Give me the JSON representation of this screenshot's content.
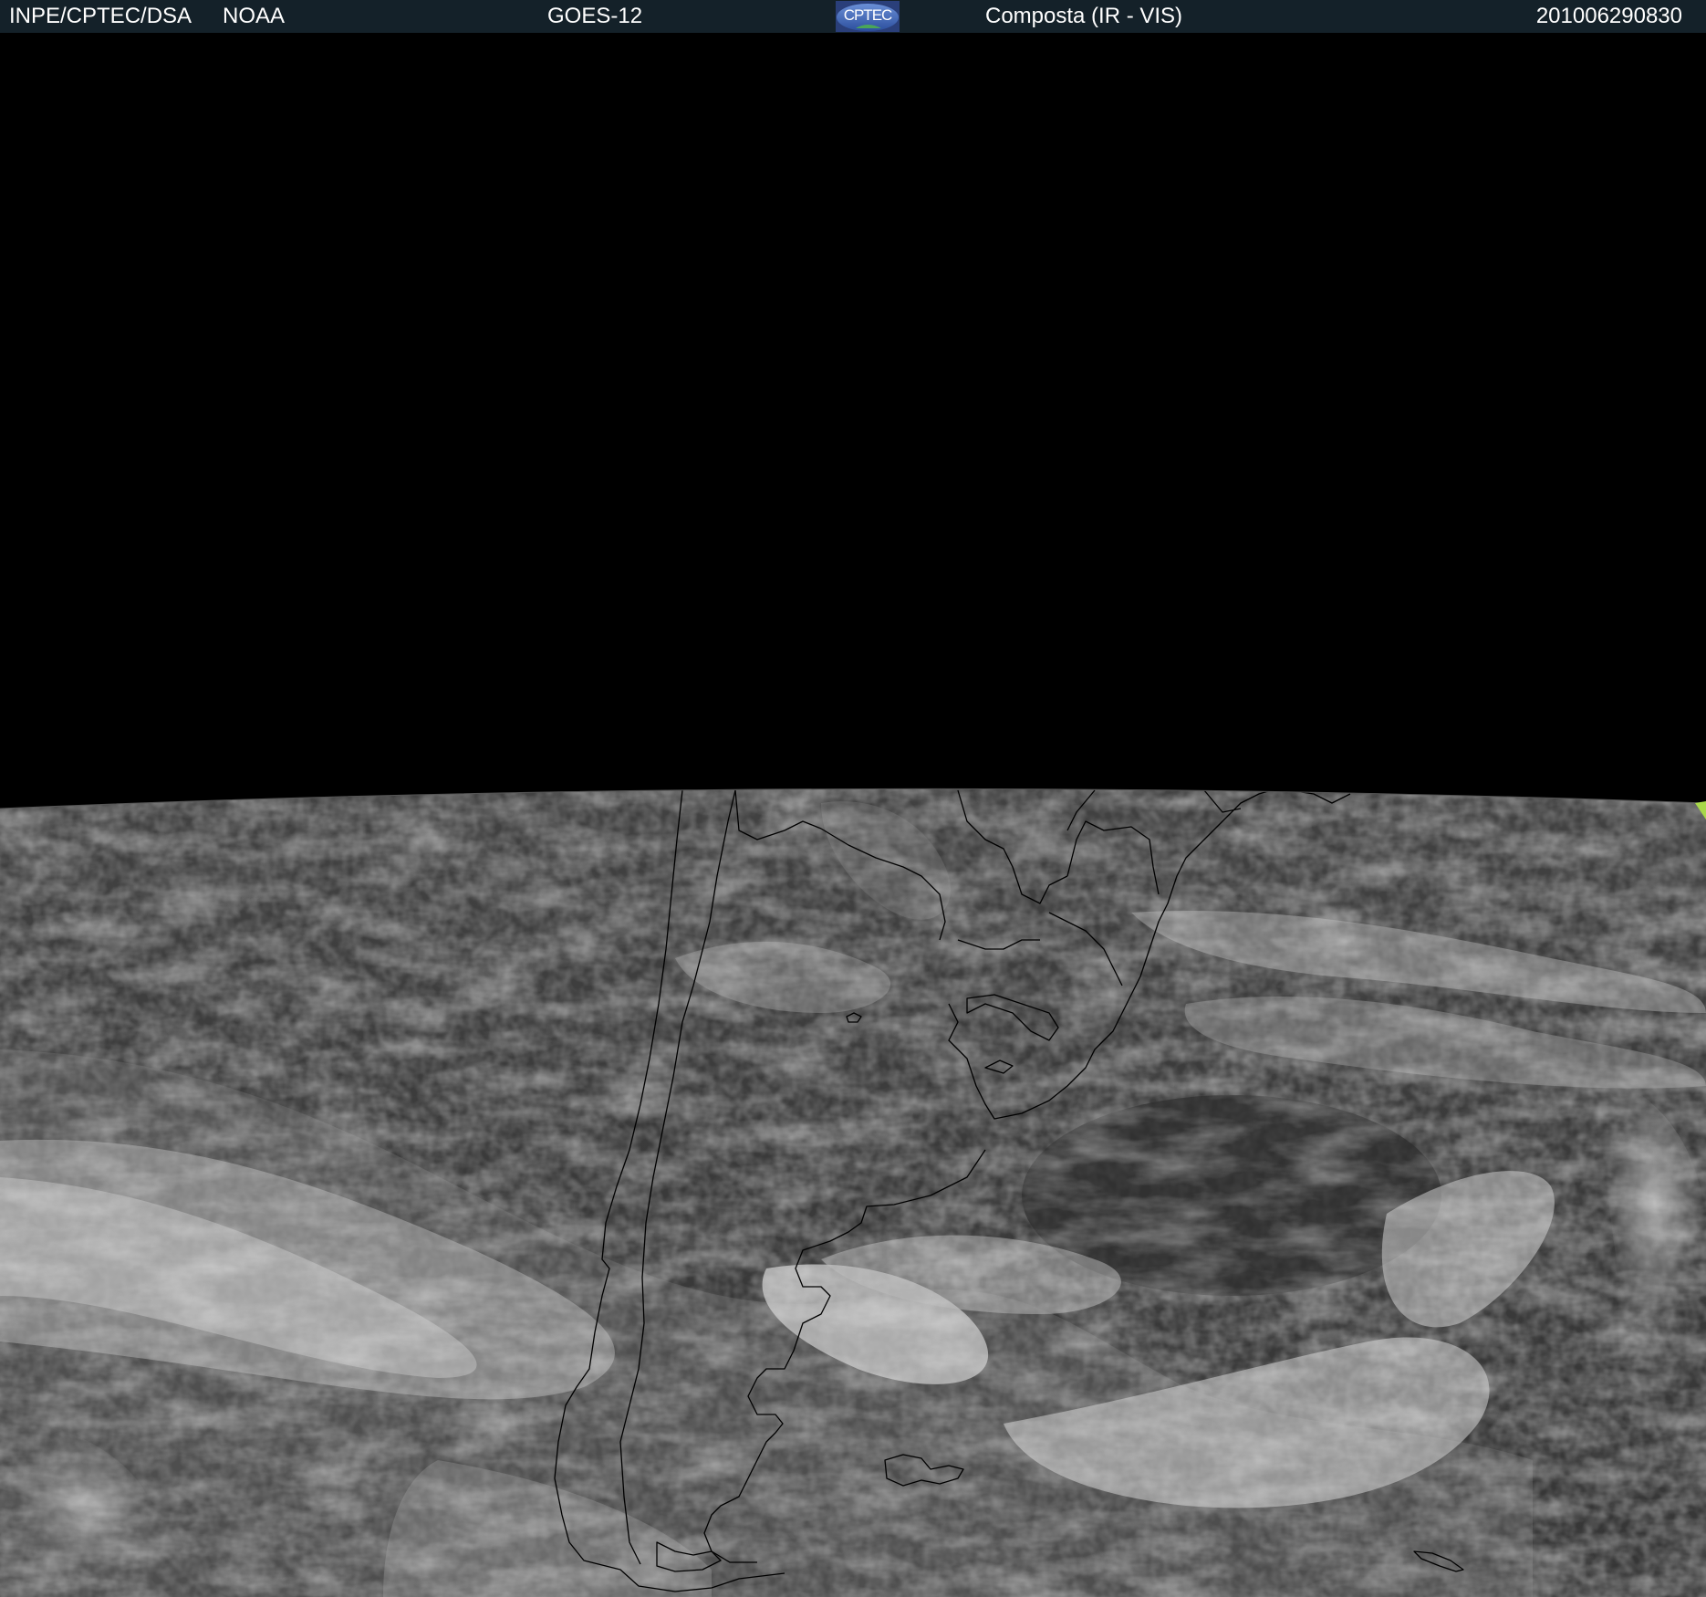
{
  "header": {
    "org": "INPE/CPTEC/DSA",
    "agency": "NOAA",
    "satellite": "GOES-12",
    "product": "Composta (IR - VIS)",
    "timestamp": "201006290830"
  },
  "logo": {
    "text": "CPTEC",
    "icon": "cptec-logo-icon"
  },
  "colors": {
    "header_bg": "#142129",
    "header_text": "#ffffff",
    "space": "#000000",
    "earth_base": "#3a3a3a",
    "cloud": "#bdbdbd",
    "coastline": "#000000",
    "limb_marker": "#a8d84a"
  }
}
